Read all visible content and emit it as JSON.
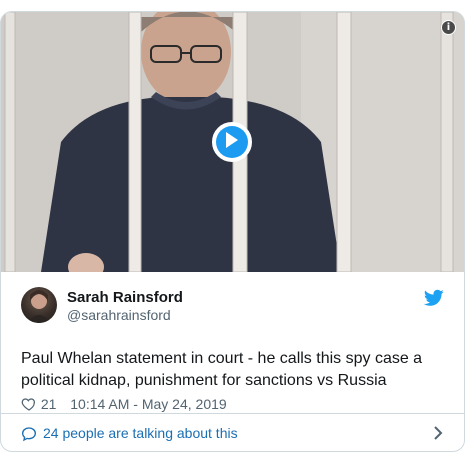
{
  "media": {
    "has_video": true,
    "play_icon": "play-icon",
    "info_icon": "info-icon",
    "info_glyph": "i",
    "accent_color": "#1d9bf0"
  },
  "tweet": {
    "author_name": "Sarah Rainsford",
    "author_handle": "@sarahrainsford",
    "text": "Paul Whelan statement in court - he calls this spy case a political kidnap, punishment for sanctions vs Russia",
    "like_count": "21",
    "timestamp": "10:14 AM - May 24, 2019",
    "brand_icon": "twitter-bird-icon",
    "brand_color": "#1da1f2"
  },
  "footer": {
    "talking_label": "24 people are talking about this",
    "link_color": "#1b6fb3"
  }
}
